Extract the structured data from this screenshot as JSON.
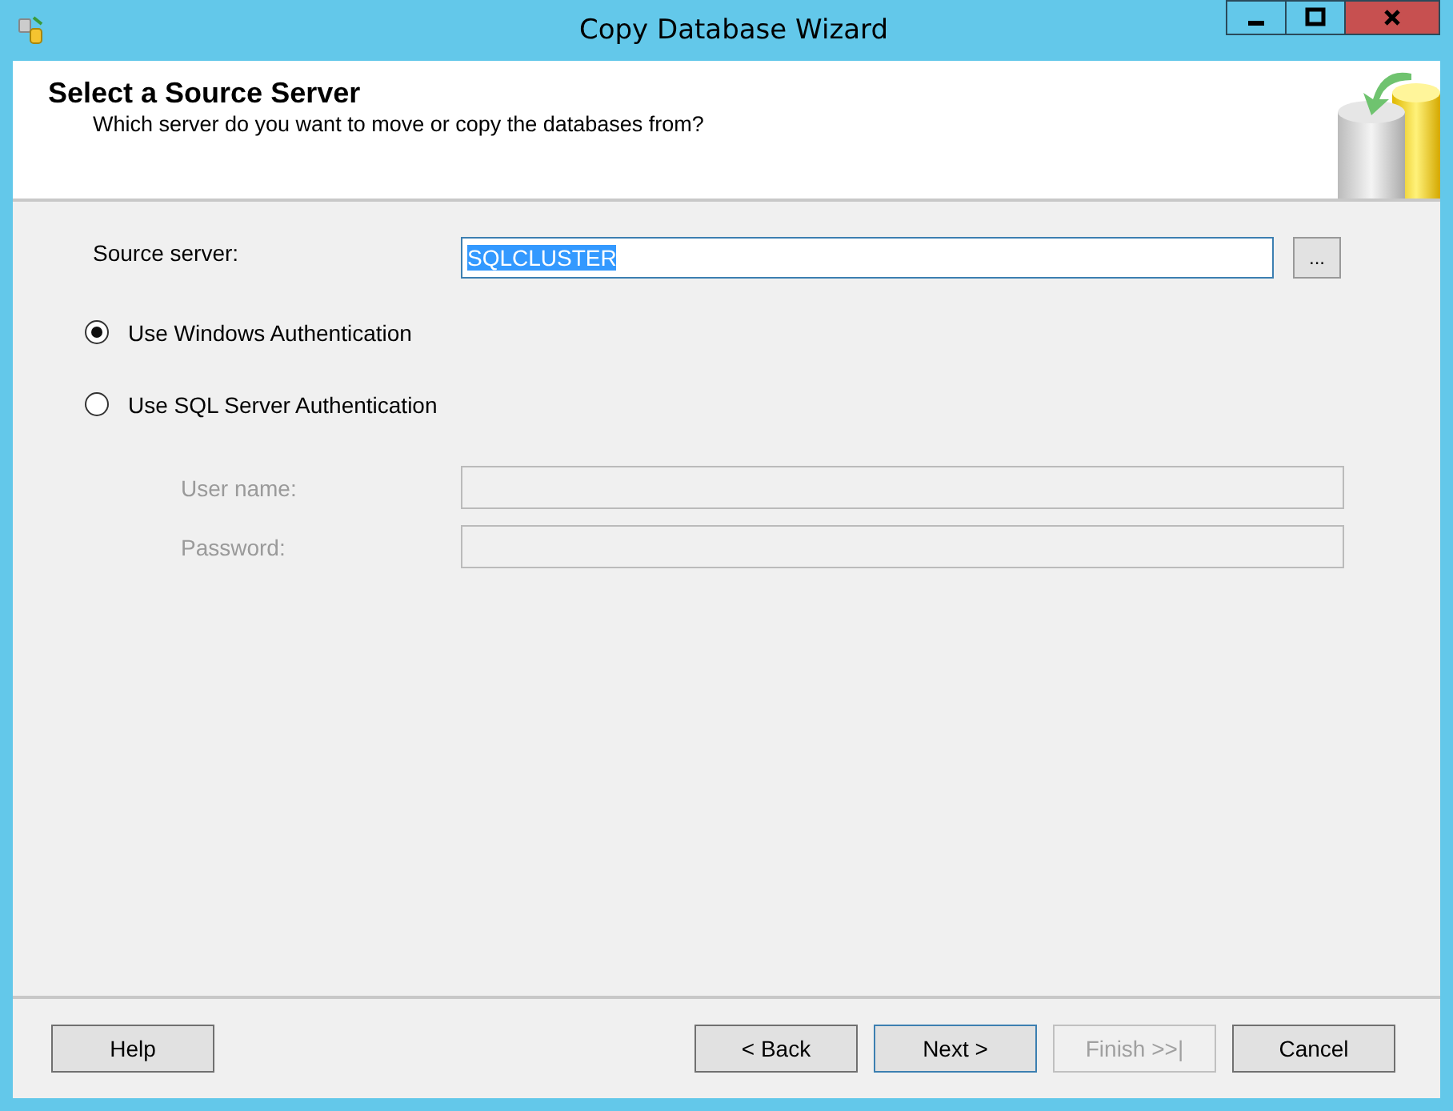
{
  "window": {
    "title": "Copy Database Wizard",
    "buttons": [
      {
        "kind": "minimize"
      },
      {
        "kind": "maximize"
      },
      {
        "kind": "close"
      }
    ]
  },
  "header": {
    "title": "Select a Source Server",
    "subtitle": "Which server do you want to move or copy the databases from?"
  },
  "source_server": {
    "label": "Source server:",
    "value": "SQLCLUSTER",
    "text_selected": true,
    "browse": "..."
  },
  "authentication": [
    {
      "label": "Use Windows Authentication",
      "selected": true
    },
    {
      "label": "Use SQL Server Authentication",
      "selected": false
    }
  ],
  "credentials": [
    {
      "label": "User name:",
      "disabled": true
    },
    {
      "label": "Password:",
      "disabled": true
    }
  ],
  "help_button": {
    "label": "Help",
    "disabled": false,
    "default": false
  },
  "buttons": [
    {
      "label": "< Back",
      "disabled": false,
      "default": false
    },
    {
      "label": "Next >",
      "disabled": false,
      "default": true
    },
    {
      "label": "Finish >>|",
      "disabled": true,
      "default": false
    },
    {
      "label": "Cancel",
      "disabled": false,
      "default": false
    }
  ]
}
